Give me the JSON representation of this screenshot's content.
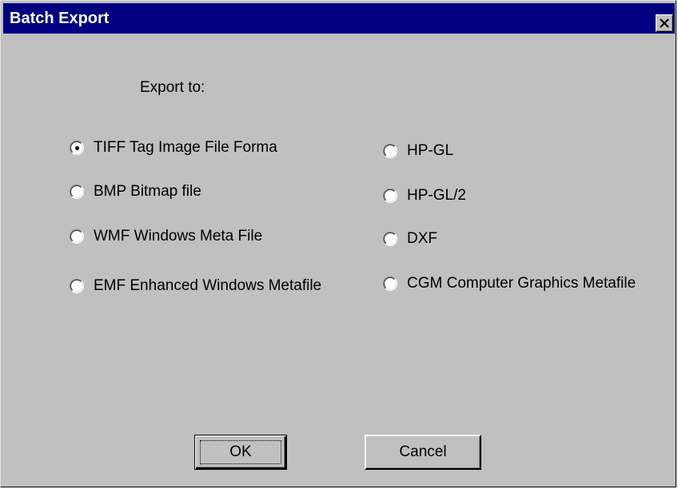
{
  "window": {
    "title": "Batch Export"
  },
  "export_label": "Export to:",
  "options_left": [
    {
      "label": "TIFF Tag Image File Forma",
      "selected": true
    },
    {
      "label": "BMP Bitmap file",
      "selected": false
    },
    {
      "label": "WMF Windows Meta File",
      "selected": false
    },
    {
      "label": "EMF Enhanced Windows Metafile",
      "selected": false
    }
  ],
  "options_right": [
    {
      "label": "HP-GL",
      "selected": false
    },
    {
      "label": "HP-GL/2",
      "selected": false
    },
    {
      "label": "DXF",
      "selected": false
    },
    {
      "label": "CGM Computer Graphics Metafile",
      "selected": false
    }
  ],
  "buttons": {
    "ok": "OK",
    "cancel": "Cancel"
  },
  "colors": {
    "titlebar": "#000080",
    "face": "#c0c0c0"
  },
  "icons": {
    "close": "close-icon"
  }
}
